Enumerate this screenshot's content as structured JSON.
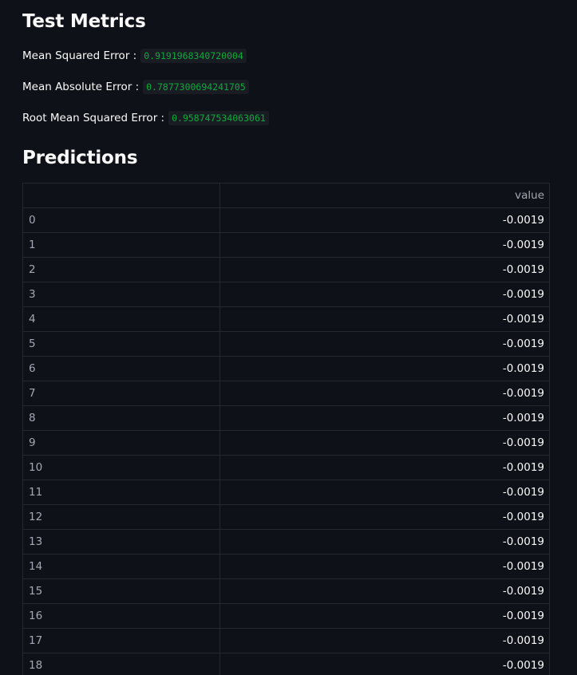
{
  "sections": {
    "metrics_title": "Test Metrics",
    "predictions_title": "Predictions"
  },
  "metrics": [
    {
      "label": "Mean Squared Error :",
      "value": "0.9191968340720004"
    },
    {
      "label": "Mean Absolute Error :",
      "value": "0.7877300694241705"
    },
    {
      "label": "Root Mean Squared Error :",
      "value": "0.958747534063061"
    }
  ],
  "table": {
    "index_header": "",
    "value_header": "value",
    "rows": [
      {
        "index": "0",
        "value": "-0.0019"
      },
      {
        "index": "1",
        "value": "-0.0019"
      },
      {
        "index": "2",
        "value": "-0.0019"
      },
      {
        "index": "3",
        "value": "-0.0019"
      },
      {
        "index": "4",
        "value": "-0.0019"
      },
      {
        "index": "5",
        "value": "-0.0019"
      },
      {
        "index": "6",
        "value": "-0.0019"
      },
      {
        "index": "7",
        "value": "-0.0019"
      },
      {
        "index": "8",
        "value": "-0.0019"
      },
      {
        "index": "9",
        "value": "-0.0019"
      },
      {
        "index": "10",
        "value": "-0.0019"
      },
      {
        "index": "11",
        "value": "-0.0019"
      },
      {
        "index": "12",
        "value": "-0.0019"
      },
      {
        "index": "13",
        "value": "-0.0019"
      },
      {
        "index": "14",
        "value": "-0.0019"
      },
      {
        "index": "15",
        "value": "-0.0019"
      },
      {
        "index": "16",
        "value": "-0.0019"
      },
      {
        "index": "17",
        "value": "-0.0019"
      },
      {
        "index": "18",
        "value": "-0.0019"
      }
    ]
  }
}
